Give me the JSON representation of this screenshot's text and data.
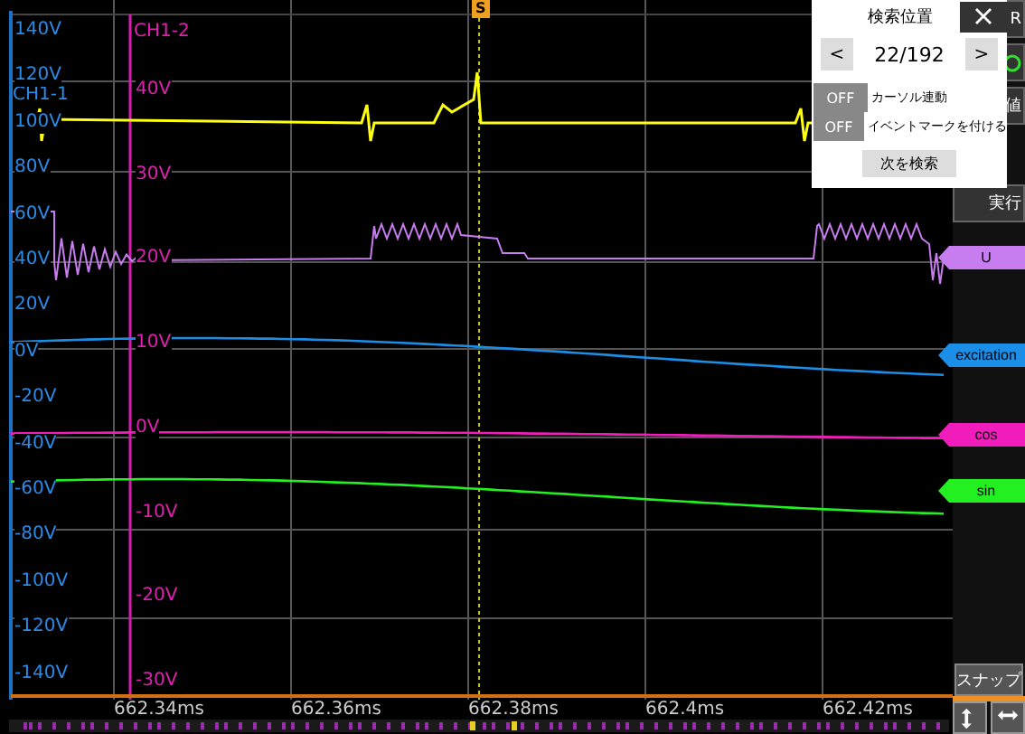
{
  "trigger_marker": "S",
  "left_axis": {
    "title": "CH1-1",
    "ticks": [
      "140V",
      "120V",
      "100V",
      "80V",
      "60V",
      "40V",
      "20V",
      "0V",
      "-20V",
      "-40V",
      "-60V",
      "-80V",
      "-100V",
      "-120V",
      "-140V"
    ]
  },
  "middle_axis": {
    "title": "CH1-2",
    "ticks": [
      "40V",
      "30V",
      "20V",
      "10V",
      "0V",
      "-10V",
      "-20V",
      "-30V"
    ]
  },
  "channel_labels": [
    {
      "label": "U",
      "color": "#c77cf0"
    },
    {
      "label": "excitation",
      "color": "#1b8fe8"
    },
    {
      "label": "cos",
      "color": "#f01cbc"
    },
    {
      "label": "sin",
      "color": "#22f020"
    }
  ],
  "time_axis": {
    "ticks": [
      "662.34ms",
      "662.36ms",
      "662.38ms",
      "662.4ms",
      "662.42ms"
    ]
  },
  "side_buttons": [
    {
      "label": "R"
    },
    {
      "label": "値"
    },
    {
      "label": "実行"
    }
  ],
  "search_popup": {
    "title": "検索位置",
    "prev": "<",
    "counter": "22/192",
    "next": ">",
    "toggles": [
      {
        "state": "OFF",
        "on": false,
        "label": "カーソル連動"
      },
      {
        "state": "OFF",
        "on": false,
        "label": "イベントマークを付ける"
      }
    ],
    "search_button": "次を検索"
  },
  "snap_button": "スナップ"
}
